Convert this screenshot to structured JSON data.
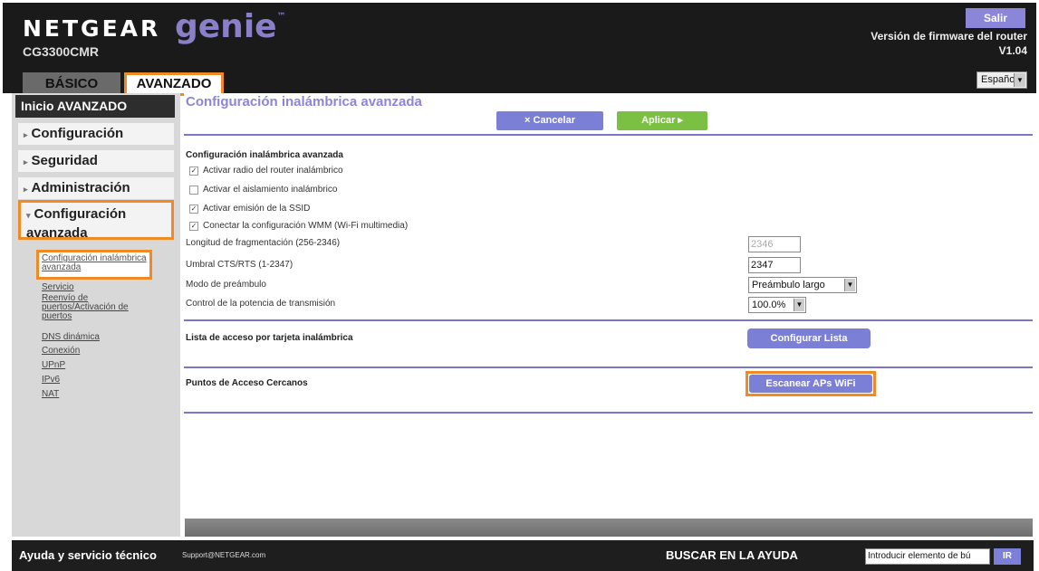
{
  "header": {
    "brand": "NETGEAR",
    "brand_genie": "genie",
    "trademark": "™",
    "model": "CG3300CMR",
    "logout_label": "Salir",
    "firmware_label": "Versión de firmware del router",
    "firmware_version": "V1.04",
    "tabs": [
      {
        "label": "BÁSICO"
      },
      {
        "label": "AVANZADO"
      }
    ],
    "language": "Español"
  },
  "sidebar": {
    "home": "Inicio AVANZADO",
    "items": [
      {
        "label": "Configuración"
      },
      {
        "label": "Seguridad"
      },
      {
        "label": "Administración"
      },
      {
        "label": "Configuración avanzada"
      }
    ],
    "submenu": [
      {
        "label": "Configuración inalámbrica avanzada"
      },
      {
        "label": "Servicio"
      },
      {
        "label": "Reenvío de puertos/Activación de puertos"
      },
      {
        "label": "DNS dinámica"
      },
      {
        "label": "Conexión"
      },
      {
        "label": "UPnP"
      },
      {
        "label": "IPv6"
      },
      {
        "label": "NAT"
      }
    ]
  },
  "main": {
    "title": "Configuración inalámbrica avanzada",
    "cancel_label": "Cancelar",
    "apply_label": "Aplicar",
    "section_title": "Configuración inalámbrica avanzada",
    "checkboxes": [
      {
        "label": "Activar radio del router inalámbrico",
        "checked": true
      },
      {
        "label": "Activar el aislamiento inalámbrico",
        "checked": false
      },
      {
        "label": "Activar emisión de la SSID",
        "checked": true
      },
      {
        "label": "Conectar la configuración WMM (Wi-Fi multimedia)",
        "checked": true
      }
    ],
    "fragmentation_label": "Longitud de fragmentación (256-2346)",
    "fragmentation_value": "2346",
    "cts_label": "Umbral CTS/RTS (1-2347)",
    "cts_value": "2347",
    "preamble_label": "Modo de preámbulo",
    "preamble_value": "Preámbulo largo",
    "power_label": "Control de la potencia de transmisión",
    "power_value": "100.0%",
    "access_list_label": "Lista de acceso por tarjeta inalámbrica",
    "config_list_button": "Configurar Lista",
    "nearby_ap_label": "Puntos de Acceso Cercanos",
    "scan_button": "Escanear APs WiFi"
  },
  "footer": {
    "help_title": "Ayuda y servicio técnico",
    "support_link": "Support@NETGEAR.com",
    "search_label": "BUSCAR EN LA AYUDA",
    "search_placeholder": "Introducir elemento de bú",
    "search_button": "IR"
  },
  "colors": {
    "accent_purple": "#7c7fd6",
    "apply_green": "#7bc043",
    "highlight_orange": "#f08a24",
    "header_dark": "#1a1a1a"
  }
}
